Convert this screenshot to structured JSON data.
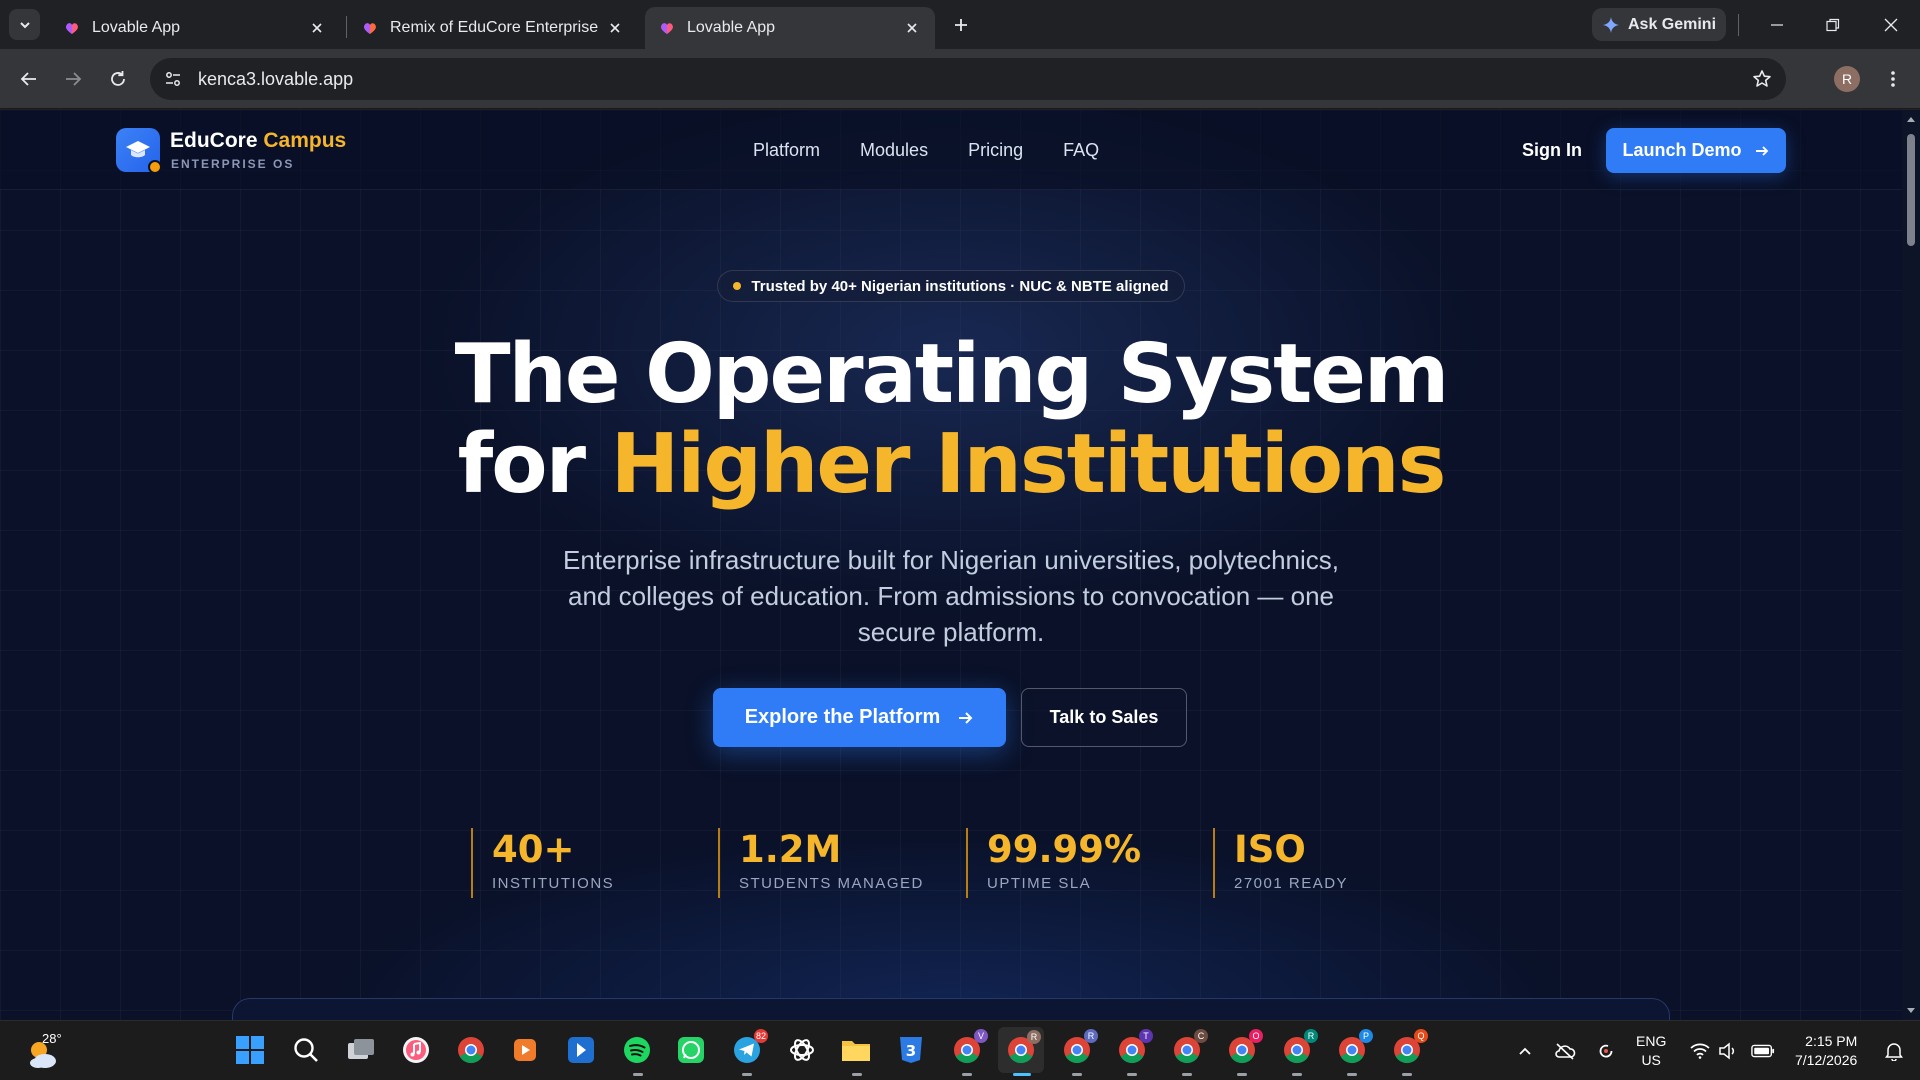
{
  "browser": {
    "tabs": [
      {
        "title": "Lovable App",
        "active": false
      },
      {
        "title": "Remix of EduCore Enterprise | L",
        "active": false
      },
      {
        "title": "Lovable App",
        "active": true
      }
    ],
    "gemini_label": "Ask Gemini",
    "url": "kenca3.lovable.app",
    "profile_initial": "R"
  },
  "site": {
    "brand": {
      "name": "EduCore",
      "accent": "Campus",
      "subtitle": "ENTERPRISE OS"
    },
    "nav": [
      "Platform",
      "Modules",
      "Pricing",
      "FAQ"
    ],
    "sign_in": "Sign In",
    "launch_demo": "Launch Demo",
    "trust_badge": "Trusted by 40+ Nigerian institutions · NUC & NBTE aligned",
    "hero": {
      "line1": "The Operating System",
      "line2_prefix": "for ",
      "line2_accent": "Higher Institutions",
      "subtitle": "Enterprise infrastructure built for Nigerian universities, polytechnics, and colleges of education. From admissions to convocation — one secure platform."
    },
    "cta_primary": "Explore the Platform",
    "cta_secondary": "Talk to Sales",
    "stats": [
      {
        "value": "40+",
        "label": "INSTITUTIONS"
      },
      {
        "value": "1.2M",
        "label": "STUDENTS MANAGED"
      },
      {
        "value": "99.99%",
        "label": "UPTIME SLA"
      },
      {
        "value": "ISO",
        "label": "27001 READY"
      }
    ],
    "colors": {
      "accent": "#f5b62b",
      "primary": "#2f7cf6",
      "background": "#0a1128"
    }
  },
  "taskbar": {
    "weather_temp": "28°",
    "telegram_badge": "82",
    "language": {
      "line1": "ENG",
      "line2": "US"
    },
    "time": "2:15 PM",
    "date": "7/12/2026",
    "chrome_profiles": [
      "V",
      "R",
      "R",
      "T",
      "C",
      "O",
      "R",
      "P",
      "Q"
    ]
  }
}
